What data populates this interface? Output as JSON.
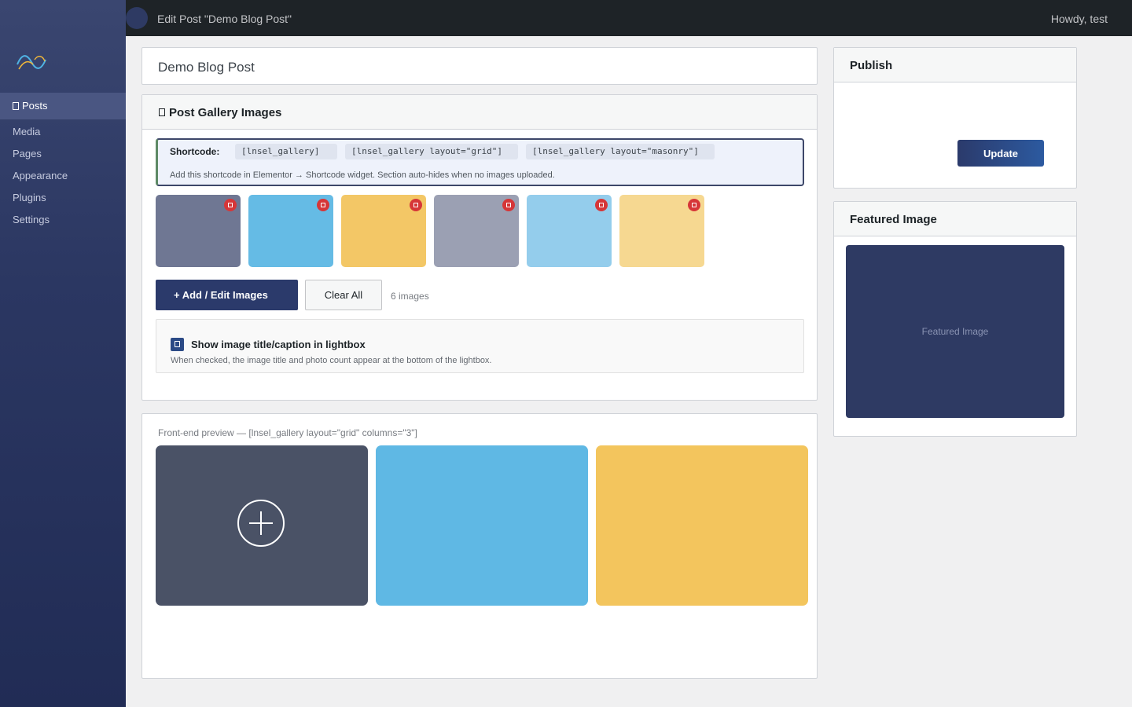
{
  "colors": {
    "sidebar_bg": "#2b3762",
    "topbar_bg": "#1e2327",
    "accent": "#2b3a6b",
    "delete_badge": "#d63638"
  },
  "sidebar": {
    "logo_icon": "infinity-logo-icon",
    "items": [
      {
        "label": "Posts",
        "icon": "posts-icon",
        "active": true
      },
      {
        "label": "Media"
      },
      {
        "label": "Pages"
      },
      {
        "label": "Appearance"
      },
      {
        "label": "Plugins"
      },
      {
        "label": "Settings"
      }
    ]
  },
  "topbar": {
    "title": "Edit Post \"Demo Blog Post\"",
    "greeting": "Howdy, test"
  },
  "post": {
    "title": "Demo Blog Post"
  },
  "gallery_box": {
    "title": "Post Gallery Images",
    "shortcode_label": "Shortcode:",
    "shortcodes": [
      "[lnsel_gallery]",
      "[lnsel_gallery layout=\"grid\"]",
      "[lnsel_gallery layout=\"masonry\"]"
    ],
    "shortcode_note": "Add this shortcode in Elementor → Shortcode widget. Section auto-hides when no images uploaded.",
    "images": [
      {
        "color": "#6f7793"
      },
      {
        "color": "#65bbe5"
      },
      {
        "color": "#f3c766"
      },
      {
        "color": "#9ba0b3"
      },
      {
        "color": "#94cdec"
      },
      {
        "color": "#f6d891"
      }
    ],
    "add_button": "+ Add / Edit Images",
    "clear_button": "Clear All",
    "count_text": "6 images",
    "lightbox_checked": true,
    "lightbox_label": "Show image title/caption in lightbox",
    "lightbox_desc": "When checked, the image title and photo count appear at the bottom of the lightbox."
  },
  "preview": {
    "caption": "Front-end preview — [lnsel_gallery layout=\"grid\" columns=\"3\"]",
    "tiles": [
      {
        "color": "#4a5266",
        "icon": "plus-circle-icon"
      },
      {
        "color": "#5fb8e4"
      },
      {
        "color": "#f3c55d"
      }
    ]
  },
  "publish": {
    "title": "Publish",
    "update_button": "Update"
  },
  "featured": {
    "title": "Featured Image",
    "placeholder": "Featured Image"
  }
}
